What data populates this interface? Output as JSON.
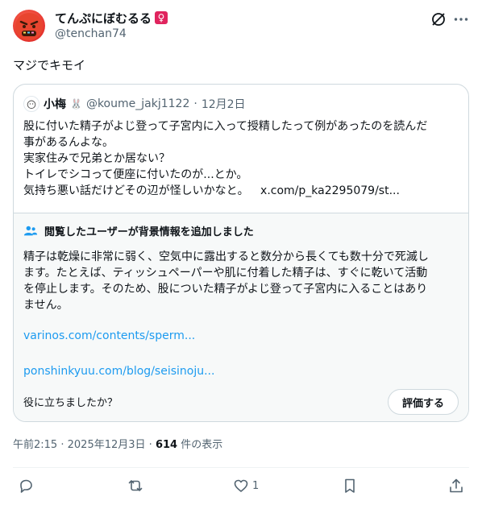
{
  "user": {
    "display_name": "てんぷにぼむるる",
    "gender_badge": "♀",
    "handle": "@tenchan74"
  },
  "tweet": {
    "text": "マジでキモイ"
  },
  "quote": {
    "name": "小梅",
    "handle": "@koume_jakj1122",
    "separator": "·",
    "date": "12月2日",
    "lines": [
      "股に付いた精子がよじ登って子宮内に入って授精したって例があったのを読んだ",
      "事があるんよな。",
      "実家住みで兄弟とか居ない？",
      "トイレでシコって便座に付いたのが...とか。",
      "気持ち悪い話だけどその辺が怪しいかなと。"
    ],
    "link": "x.com/p_ka2295079/st..."
  },
  "notes": {
    "header": "閲覧したユーザーが背景情報を追加しました",
    "body_lines": [
      "精子は乾燥に非常に弱く、空気中に露出すると数分から長くても数十分で死滅し",
      "ます。たとえば、ティッシュペーパーや肌に付着した精子は、すぐに乾いて活動",
      "を停止します。そのため、股についた精子がよじ登って子宮内に入ることはあり",
      "ません。"
    ],
    "link1": "varinos.com/contents/sperm...",
    "link2": "ponshinkyuu.com/blog/seisinoju...",
    "helpful_question": "役に立ちましたか？",
    "rate_button": "評価する"
  },
  "meta": {
    "time": "午前2:15",
    "sep": "·",
    "date": "2025年12月3日",
    "views_count": "614",
    "views_label": "件の表示"
  },
  "actions": {
    "like_count": "1"
  },
  "icons": [
    "face-with-symbols-avatar",
    "grok-icon",
    "more-icon",
    "notes-people-icon",
    "reply-icon",
    "retweet-icon",
    "like-icon",
    "bookmark-icon",
    "share-icon"
  ],
  "colors": {
    "link": "#1d9bf0",
    "secondary_text": "#536471",
    "badge": "#e0245e"
  }
}
